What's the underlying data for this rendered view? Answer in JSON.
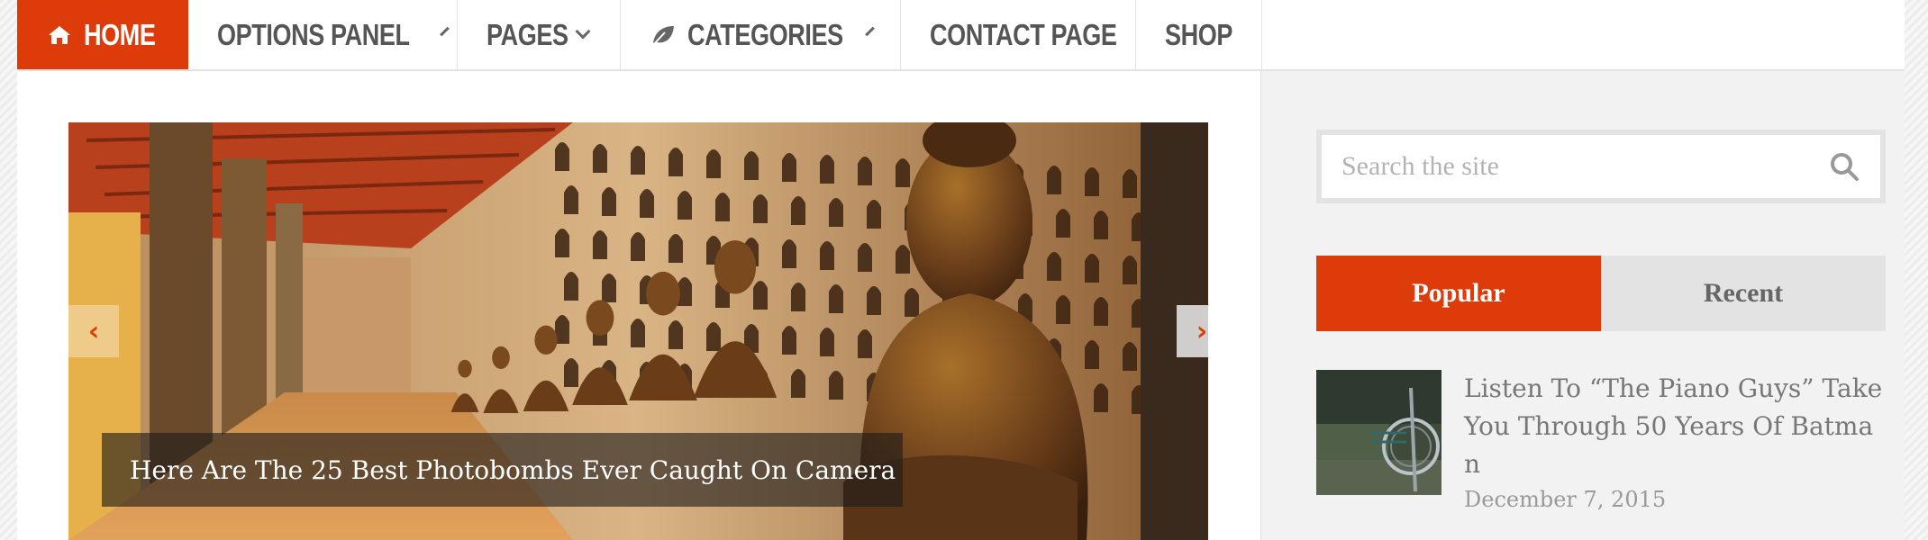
{
  "nav": {
    "items": [
      {
        "label": "HOME",
        "icon": "home-icon",
        "active": true,
        "dropdown": false
      },
      {
        "label": "OPTIONS PANEL",
        "dropdown": true
      },
      {
        "label": "PAGES",
        "dropdown": true
      },
      {
        "label": "CATEGORIES",
        "icon": "leaf-icon",
        "dropdown": true
      },
      {
        "label": "CONTACT PAGE",
        "dropdown": false
      },
      {
        "label": "SHOP",
        "dropdown": false
      }
    ]
  },
  "slider": {
    "caption": "Here Are The 25 Best Photobombs Ever Caught On Camera",
    "prev_label": "‹",
    "next_label": "›"
  },
  "sidebar": {
    "search": {
      "placeholder": "Search the site"
    },
    "tabs": [
      {
        "label": "Popular",
        "active": true
      },
      {
        "label": "Recent",
        "active": false
      }
    ],
    "posts": [
      {
        "title": "Listen To “The Piano Guys” Take You Through 50 Years Of Batman",
        "date": "December 7, 2015"
      }
    ]
  },
  "colors": {
    "accent": "#dd3c0a",
    "text": "#555555",
    "muted": "#999999"
  }
}
